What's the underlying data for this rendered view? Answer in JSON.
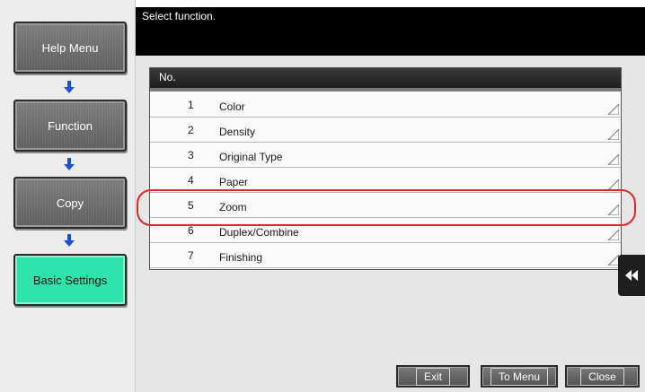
{
  "header": {
    "message": "Select function."
  },
  "nav": {
    "items": [
      {
        "label": "Help Menu"
      },
      {
        "label": "Function"
      },
      {
        "label": "Copy"
      },
      {
        "label": "Basic Settings"
      }
    ],
    "active_color": "#2fe3ac",
    "arrow_color": "#1a52d8"
  },
  "table": {
    "column_header": "No.",
    "rows": [
      {
        "no": "1",
        "name": "Color"
      },
      {
        "no": "2",
        "name": "Density"
      },
      {
        "no": "3",
        "name": "Original Type"
      },
      {
        "no": "4",
        "name": "Paper"
      },
      {
        "no": "5",
        "name": "Zoom"
      },
      {
        "no": "6",
        "name": "Duplex/Combine"
      },
      {
        "no": "7",
        "name": "Finishing"
      }
    ]
  },
  "highlight": {
    "color": "#e0262c",
    "row_no": "5"
  },
  "footer": {
    "exit_label": "Exit",
    "to_menu_label": "To Menu",
    "close_label": "Close"
  },
  "icons": {
    "down_arrow": "down-arrow-icon",
    "row_corner": "corner-triangle-icon",
    "side_tab": "double-left-arrow-icon"
  }
}
